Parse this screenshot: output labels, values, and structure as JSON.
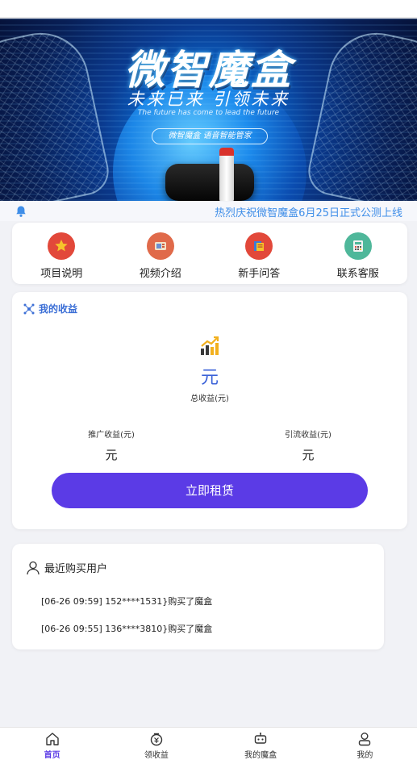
{
  "banner": {
    "title": "微智魔盒",
    "subtitle": "未来已来 引领未来",
    "tagline": "The future has come to lead the future",
    "pill_text": "微智魔盒 语音智能管家"
  },
  "notice": {
    "text": "热烈庆祝微智魔盒6月25日正式公测上线"
  },
  "quick_links": [
    {
      "label": "项目说明",
      "icon": "star-icon",
      "color": "#e2483a"
    },
    {
      "label": "视频介绍",
      "icon": "video-icon",
      "color": "#e06a4a"
    },
    {
      "label": "新手问答",
      "icon": "book-icon",
      "color": "#e2483a"
    },
    {
      "label": "联系客服",
      "icon": "calculator-icon",
      "color": "#4fb79a"
    }
  ],
  "earnings": {
    "header": "我的收益",
    "total_value": "元",
    "total_label": "总收益(元)",
    "promo_label": "推广收益(元)",
    "promo_value": "元",
    "traffic_label": "引流收益(元)",
    "traffic_value": "元",
    "rent_button": "立即租赁"
  },
  "recent": {
    "title": "最近购买用户",
    "rows": [
      "[06-26 09:59]  152****1531}购买了魔盒",
      "[06-26 09:55]  136****3810}购买了魔盒"
    ]
  },
  "tabbar": [
    {
      "label": "首页",
      "icon": "home-icon",
      "active": true
    },
    {
      "label": "领收益",
      "icon": "money-bag-icon",
      "active": false
    },
    {
      "label": "我的魔盒",
      "icon": "robot-icon",
      "active": false
    },
    {
      "label": "我的",
      "icon": "user-icon",
      "active": false
    }
  ],
  "colors": {
    "accent": "#5b3be6",
    "link_blue": "#3f8ee8",
    "earn_blue": "#3b62d8"
  }
}
